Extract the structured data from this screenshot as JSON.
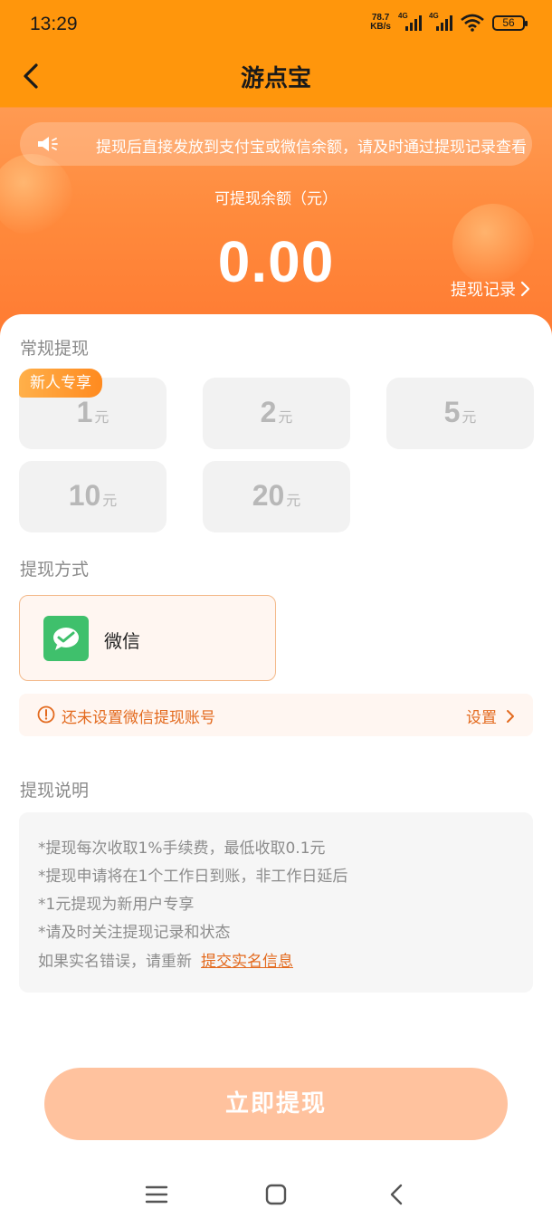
{
  "status_bar": {
    "time": "13:29",
    "net_speed_top": "78.7",
    "net_speed_bottom": "KB/s",
    "signal1_label": "4G",
    "signal2_label": "4G",
    "battery": "56"
  },
  "header": {
    "title": "游点宝",
    "back_icon": "chevron-left-icon"
  },
  "notice": {
    "icon": "speaker-icon",
    "text": "提现后直接发放到支付宝或微信余额，请及时通过提现记录查看"
  },
  "balance": {
    "label": "可提现余额（元）",
    "value": "0.00",
    "record_link": "提现记录"
  },
  "regular_withdraw": {
    "title": "常规提现",
    "badge": "新人专享",
    "unit": "元",
    "amounts": [
      "1",
      "2",
      "5",
      "10",
      "20"
    ]
  },
  "method": {
    "title": "提现方式",
    "label": "微信",
    "icon": "wechat-icon",
    "selected": true
  },
  "warning": {
    "text": "还未设置微信提现账号",
    "action": "设置"
  },
  "explain": {
    "title": "提现说明",
    "lines": [
      "*提现每次收取1%手续费，最低收取0.1元",
      "*提现申请将在1个工作日到账，非工作日延后",
      "*1元提现为新用户专享",
      "*请及时关注提现记录和状态"
    ],
    "last_prefix": "如果实名错误，请重新",
    "last_link": "提交实名信息"
  },
  "submit_label": "立即提现",
  "colors": {
    "primary": "#ff960c",
    "accent_text": "#e36a1e",
    "button_disabled": "#ffc29e",
    "wechat_green": "#3fc06c"
  }
}
